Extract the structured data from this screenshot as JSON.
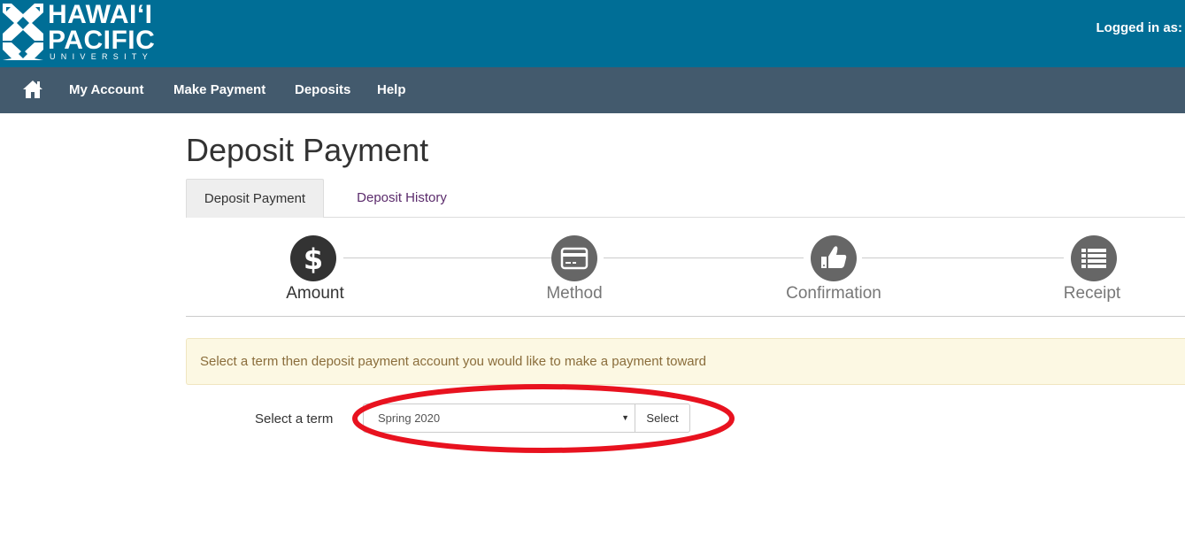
{
  "header": {
    "logo": {
      "line1": "HAWAIʻI",
      "line2": "PACIFIC",
      "line3": "UNIVERSITY"
    },
    "logged_in_label": "Logged in as:"
  },
  "nav": {
    "items": [
      {
        "label": "My Account"
      },
      {
        "label": "Make Payment"
      },
      {
        "label": "Deposits"
      },
      {
        "label": "Help"
      }
    ]
  },
  "page": {
    "title": "Deposit Payment"
  },
  "tabs": [
    {
      "label": "Deposit Payment",
      "active": true
    },
    {
      "label": "Deposit History",
      "active": false
    }
  ],
  "steps": [
    {
      "label": "Amount",
      "icon": "dollar-icon",
      "active": true
    },
    {
      "label": "Method",
      "icon": "credit-card-icon",
      "active": false
    },
    {
      "label": "Confirmation",
      "icon": "thumbs-up-icon",
      "active": false
    },
    {
      "label": "Receipt",
      "icon": "list-icon",
      "active": false
    }
  ],
  "alert": {
    "text": "Select a term then deposit payment account you would like to make a payment toward"
  },
  "term": {
    "label": "Select a term",
    "selected": "Spring 2020",
    "button_label": "Select"
  },
  "colors": {
    "header_bg": "#006e96",
    "nav_bg": "#435a6d",
    "tab_link": "#5b2b6c",
    "annotation": "#e8121f"
  }
}
